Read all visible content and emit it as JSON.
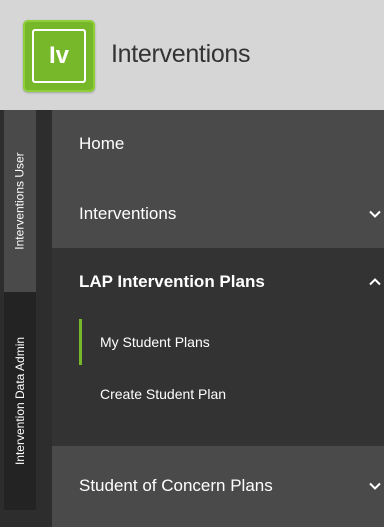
{
  "header": {
    "logo_text": "Iv",
    "app_title": "Interventions"
  },
  "rail": {
    "tabs": [
      {
        "label": "Interventions User"
      },
      {
        "label": "Intervention Data Admin"
      }
    ]
  },
  "menu": {
    "items": [
      {
        "label": "Home"
      },
      {
        "label": "Interventions",
        "expanded": false
      },
      {
        "label": "LAP Intervention Plans",
        "expanded": true
      },
      {
        "label": "Student of Concern Plans",
        "expanded": false
      }
    ],
    "lap_submenu": [
      {
        "label": "My Student Plans",
        "active": true
      },
      {
        "label": "Create Student Plan",
        "active": false
      }
    ]
  },
  "colors": {
    "accent": "#76b82a",
    "header_bg": "#d6d6d6",
    "menu_bg": "#4a4a4a",
    "panel_bg": "#333333",
    "rail_bg": "#2d2d2d"
  }
}
